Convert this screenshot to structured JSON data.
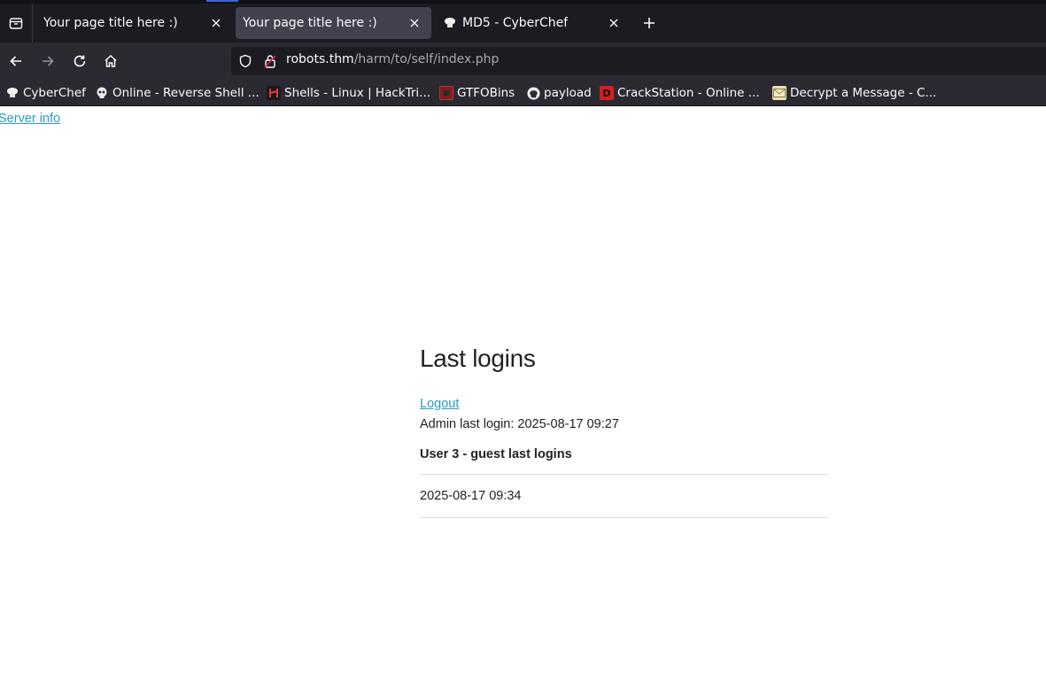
{
  "browser": {
    "tabs": [
      {
        "title": "Your page title here :)",
        "active": false,
        "favicon": "none"
      },
      {
        "title": "Your page title here :)",
        "active": true,
        "favicon": "none"
      },
      {
        "title": "MD5 - CyberChef",
        "active": false,
        "favicon": "cyberchef-icon"
      }
    ],
    "url": {
      "host": "robots.thm",
      "path": "/harm/to/self/index.php"
    },
    "bookmarks": [
      {
        "label": "CyberChef",
        "icon": "cyberchef-icon"
      },
      {
        "label": "Online - Reverse Shell ...",
        "icon": "skull-icon"
      },
      {
        "label": "Shells - Linux | HackTri...",
        "icon": "hacktricks-icon"
      },
      {
        "label": "GTFOBins",
        "icon": "gtfobins-icon"
      },
      {
        "label": "payload",
        "icon": "github-icon"
      },
      {
        "label": "CrackStation - Online ...",
        "icon": "crackstation-icon"
      },
      {
        "label": "Decrypt a Message - C...",
        "icon": "envelope-icon"
      }
    ],
    "colors": {
      "tabbar": "#1c1b22",
      "toolbar": "#2b2a33",
      "active_tab": "#42414d",
      "link": "#2a9cc6"
    }
  },
  "page": {
    "server_info_link": "Server info",
    "title": "Last logins",
    "logout_link": "Logout",
    "admin_last_login": "Admin last login: 2025-08-17 09:27",
    "user_heading": "User 3 - guest last logins",
    "logins": [
      "2025-08-17 09:34"
    ]
  }
}
